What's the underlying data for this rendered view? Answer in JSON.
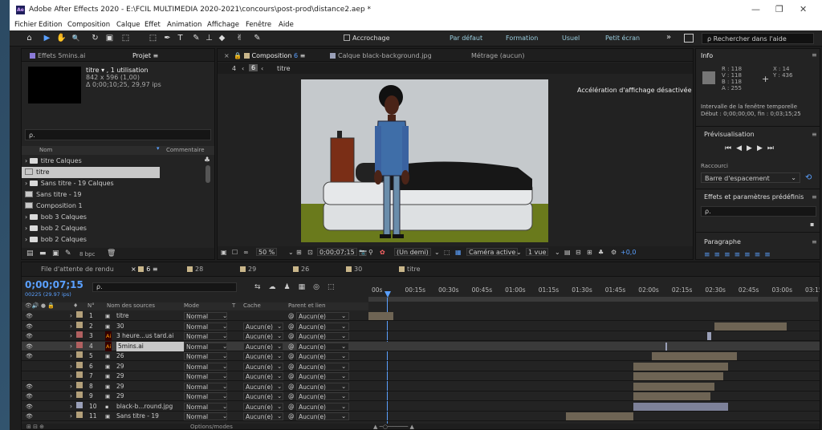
{
  "title_bar": {
    "app_badge": "Ae",
    "title": "Adobe After Effects 2020 - E:\\FCIL MULTIMEDIA 2020-2021\\concours\\post-prod\\distance2.aep *",
    "min": "—",
    "restore": "❐",
    "close": "✕"
  },
  "menu": [
    "Fichier",
    "Edition",
    "Composition",
    "Calque",
    "Effet",
    "Animation",
    "Affichage",
    "Fenêtre",
    "Aide"
  ],
  "toolbar": {
    "tools": [
      "⌂",
      "▶",
      "✋",
      "🔍",
      "↻",
      "▣",
      "⬚",
      "T",
      "✒",
      "⊥",
      "◆",
      "✌",
      "✎"
    ],
    "accrochage": "Accrochage",
    "workspaces": [
      "Par défaut",
      "Formation",
      "Usuel",
      "Petit écran"
    ],
    "more": "»",
    "search_placeholder": "Rechercher dans l'aide"
  },
  "project_panel": {
    "tabs": {
      "effects": "Effets  5mins.ai",
      "project": "Projet"
    },
    "preview_name": "titre ▾ , 1 utilisation",
    "preview_dims": "842 x 596 (1,00)",
    "preview_duration": "Δ 0;00;10;25, 29,97 ips",
    "search_icon_text": "ρ.",
    "col_name": "Nom",
    "col_comment": "Commentaire",
    "items": [
      {
        "kind": "folder",
        "name": "titre Calques"
      },
      {
        "kind": "comp",
        "name": "titre",
        "selected": true
      },
      {
        "kind": "folder",
        "name": "Sans titre - 19 Calques"
      },
      {
        "kind": "comp",
        "name": "Sans titre - 19"
      },
      {
        "kind": "comp",
        "name": "Composition 1"
      },
      {
        "kind": "folder",
        "name": "bob 3 Calques"
      },
      {
        "kind": "folder",
        "name": "bob 2 Calques"
      },
      {
        "kind": "folder",
        "name": "bob 2 Calques"
      }
    ],
    "bpc": "8 bpc"
  },
  "comp_panel": {
    "tab": "Composition",
    "tab_num": "6",
    "layer_tab": "Calque  black-background.jpg",
    "footage_tab": "Métrage  (aucun)",
    "breadcrumb_num": "4",
    "breadcrumb_current": "6",
    "breadcrumb_item": "titre",
    "accel": "Accélération d'affichage désactivée",
    "zoom": "50 %",
    "time": "0;00;07;15",
    "resolution": "(Un demi)",
    "camera": "Caméra active",
    "views": "1 vue",
    "exposure": "+0,0"
  },
  "info_panel": {
    "title": "Info",
    "r": "R : 118",
    "g": "V : 118",
    "b": "B : 118",
    "a": "A : 255",
    "x": "X : 14",
    "y": "Y : 436",
    "interval": "Intervalle de la fenêtre temporelle",
    "debut": "Début : 0;00;00;00, fin : 0;03;15;25",
    "preview_title": "Prévisualisation",
    "shortcut_label": "Raccourci",
    "shortcut_value": "Barre d'espacement",
    "effects_title": "Effets et paramètres prédéfinis",
    "effects_search": "ρ.",
    "paragraph_title": "Paragraphe",
    "color": "#767676"
  },
  "timeline": {
    "tabs": [
      {
        "label": "File d'attente de rendu",
        "color": ""
      },
      {
        "label": "6",
        "color": "#c9b68a",
        "active": true
      },
      {
        "label": "28",
        "color": "#c9b68a"
      },
      {
        "label": "29",
        "color": "#c9b68a"
      },
      {
        "label": "26",
        "color": "#c9b68a"
      },
      {
        "label": "30",
        "color": "#c9b68a"
      },
      {
        "label": "titre",
        "color": "#c9b68a"
      }
    ],
    "timecode": "0;00;07;15",
    "fps": "00225 (29.97 ips)",
    "search": "ρ.",
    "headers": {
      "num": "N°",
      "name": "Nom des sources",
      "mode": "Mode",
      "t": "T",
      "cache": "Cache",
      "parent": "Parent et lien"
    },
    "ruler": [
      "00s",
      "00:15s",
      "00:30s",
      "00:45s",
      "01:00s",
      "01:15s",
      "01:30s",
      "01:45s",
      "02:00s",
      "02:15s",
      "02:30s",
      "02:45s",
      "03:00s",
      "03:15"
    ],
    "layers": [
      {
        "n": "1",
        "name": "titre",
        "mode": "Normal",
        "cache": "",
        "parent": "Aucun(e)",
        "color": "#b3a07a",
        "eye": true,
        "type": "comp",
        "bar": [
          0.0,
          0.055
        ],
        "barcolor": "#6e6454"
      },
      {
        "n": "2",
        "name": "30",
        "mode": "Normal",
        "cache": "Aucun(e)",
        "parent": "Aucun(e)",
        "color": "#b3a07a",
        "eye": true,
        "type": "comp",
        "bar": [
          0.77,
          0.93
        ],
        "barcolor": "#6e6454"
      },
      {
        "n": "3",
        "name": "3 heure...us tard.ai",
        "mode": "Normal",
        "cache": "Aucun(e)",
        "parent": "Aucun(e)",
        "color": "#b06060",
        "eye": true,
        "type": "ai",
        "bar": [
          0.754,
          0.762
        ],
        "barcolor": "#9aa0b8"
      },
      {
        "n": "4",
        "name": "5mins.ai",
        "mode": "Normal",
        "cache": "Aucun(e)",
        "parent": "Aucun(e)",
        "color": "#b06060",
        "eye": true,
        "type": "ai",
        "bar": [
          0.66,
          0.663
        ],
        "barcolor": "#9aa0b8",
        "selected": true
      },
      {
        "n": "5",
        "name": "26",
        "mode": "Normal",
        "cache": "Aucun(e)",
        "parent": "Aucun(e)",
        "color": "#b3a07a",
        "eye": true,
        "type": "comp",
        "bar": [
          0.63,
          0.82
        ],
        "barcolor": "#6e6454"
      },
      {
        "n": "6",
        "name": "29",
        "mode": "Normal",
        "cache": "Aucun(e)",
        "parent": "Aucun(e)",
        "color": "#b3a07a",
        "eye": false,
        "type": "comp",
        "bar": [
          0.59,
          0.8
        ],
        "barcolor": "#6e6454"
      },
      {
        "n": "7",
        "name": "29",
        "mode": "Normal",
        "cache": "Aucun(e)",
        "parent": "Aucun(e)",
        "color": "#b3a07a",
        "eye": false,
        "type": "comp",
        "bar": [
          0.59,
          0.79
        ],
        "barcolor": "#6e6454"
      },
      {
        "n": "8",
        "name": "29",
        "mode": "Normal",
        "cache": "Aucun(e)",
        "parent": "Aucun(e)",
        "color": "#b3a07a",
        "eye": true,
        "type": "comp",
        "bar": [
          0.59,
          0.77
        ],
        "barcolor": "#6e6454"
      },
      {
        "n": "9",
        "name": "29",
        "mode": "Normal",
        "cache": "Aucun(e)",
        "parent": "Aucun(e)",
        "color": "#b3a07a",
        "eye": true,
        "type": "comp",
        "bar": [
          0.59,
          0.76
        ],
        "barcolor": "#6e6454"
      },
      {
        "n": "10",
        "name": "black-b...round.jpg",
        "mode": "Normal",
        "cache": "Aucun(e)",
        "parent": "Aucun(e)",
        "color": "#9aa0b8",
        "eye": true,
        "type": "img",
        "bar": [
          0.59,
          0.8
        ],
        "barcolor": "#7d8199"
      },
      {
        "n": "11",
        "name": "Sans titre - 19",
        "mode": "Normal",
        "cache": "Aucun(e)",
        "parent": "Aucun(e)",
        "color": "#b3a07a",
        "eye": true,
        "type": "comp",
        "bar": [
          0.44,
          0.59
        ],
        "barcolor": "#6e6454"
      }
    ],
    "footer": "Options/modes"
  }
}
